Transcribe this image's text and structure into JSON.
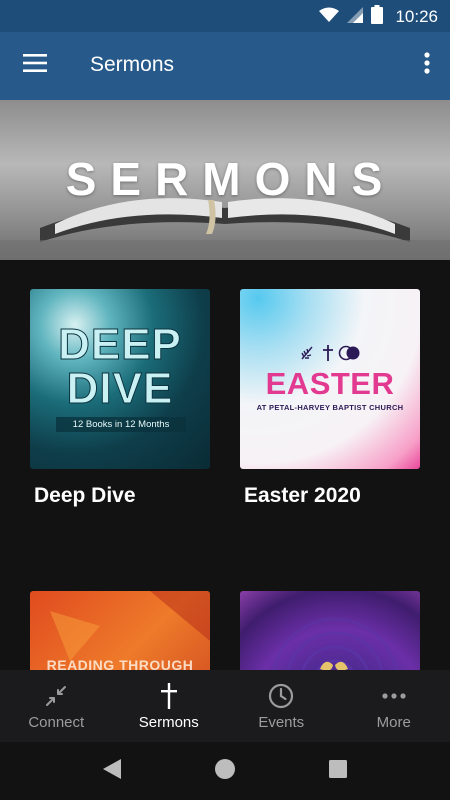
{
  "status_bar": {
    "time": "10:26"
  },
  "app_bar": {
    "title": "Sermons"
  },
  "hero": {
    "text": "SERMONS"
  },
  "sermons": [
    {
      "title": "Deep Dive",
      "thumb_title": "DEEP DIVE",
      "thumb_subtitle": "12 Books in 12 Months"
    },
    {
      "title": "Easter 2020",
      "thumb_title": "EASTER",
      "thumb_subtitle": "AT PETAL-HARVEY BAPTIST CHURCH"
    },
    {
      "title": "",
      "thumb_text": "READING THROUGH THE"
    },
    {
      "title": ""
    }
  ],
  "bottom_nav": {
    "items": [
      {
        "label": "Connect",
        "icon": "connect-icon",
        "active": false
      },
      {
        "label": "Sermons",
        "icon": "cross-icon",
        "active": true
      },
      {
        "label": "Events",
        "icon": "clock-icon",
        "active": false
      },
      {
        "label": "More",
        "icon": "more-dots-icon",
        "active": false
      }
    ]
  },
  "colors": {
    "status_bar": "#1f4d79",
    "app_bar": "#275a8a",
    "background": "#121212",
    "bottom_nav": "#1b1b1d",
    "active_label": "#ffffff",
    "inactive_label": "#9c9c9c"
  }
}
